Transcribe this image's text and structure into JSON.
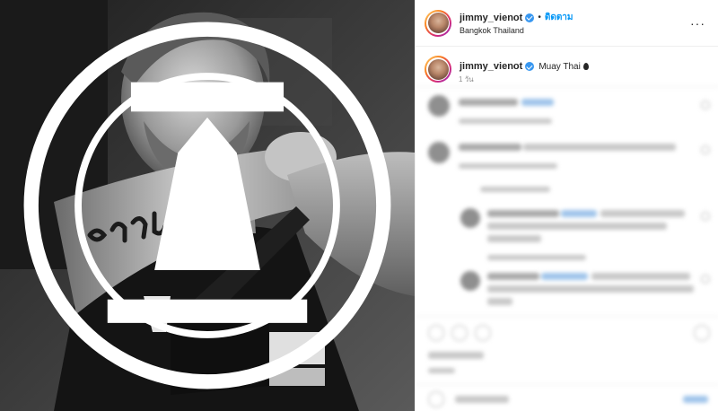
{
  "post": {
    "username": "jimmy_vienot",
    "follow_label": "ติดตาม",
    "dot": "•",
    "location": "Bangkok Thailand",
    "more_label": "···"
  },
  "caption": {
    "username": "jimmy_vienot",
    "text": "Muay Thai",
    "time_label": "1 วัน"
  },
  "icons": {
    "verified": "verified-badge-icon",
    "more": "more-options-icon",
    "fire": "fire-icon"
  },
  "colors": {
    "accent": "#0095f6",
    "verified": "#3897f0",
    "text": "#262626",
    "muted": "#8e8e8e"
  }
}
